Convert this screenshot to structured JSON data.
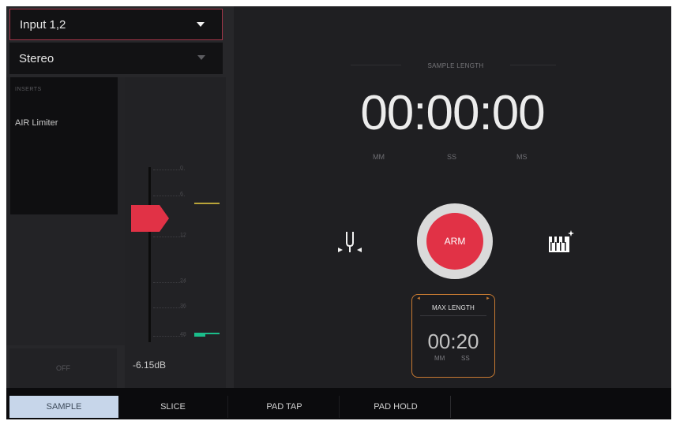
{
  "input_select": {
    "value": "Input 1,2"
  },
  "mode_select": {
    "value": "Stereo"
  },
  "inserts": {
    "header": "INSERTS",
    "items": [
      "AIR Limiter"
    ]
  },
  "fader": {
    "value_label": "-6.15dB",
    "scale": [
      "0",
      "6",
      "12",
      "24",
      "36",
      "48"
    ]
  },
  "off_button": {
    "label": "OFF"
  },
  "sample_length": {
    "label": "SAMPLE LENGTH",
    "value": "00:00:00",
    "units": [
      "MM",
      "SS",
      "MS"
    ]
  },
  "arm_button": {
    "label": "ARM"
  },
  "max_length": {
    "title": "MAX LENGTH",
    "value": "00:20",
    "units": [
      "MM",
      "SS"
    ],
    "corner_left": "◄",
    "corner_right": "►"
  },
  "tabs": [
    {
      "label": "SAMPLE",
      "selected": true
    },
    {
      "label": "SLICE",
      "selected": false
    },
    {
      "label": "PAD TAP",
      "selected": false
    },
    {
      "label": "PAD HOLD",
      "selected": false
    }
  ],
  "colors": {
    "accent_red": "#e13246",
    "orange": "#c77a32",
    "tab_selected": "#c7d6ea",
    "meter_yellow": "#b9a43a",
    "meter_green": "#1bbd8a"
  },
  "icons": [
    "tuning-fork-icon",
    "piano-keys-icon",
    "chevron-down-icon"
  ]
}
